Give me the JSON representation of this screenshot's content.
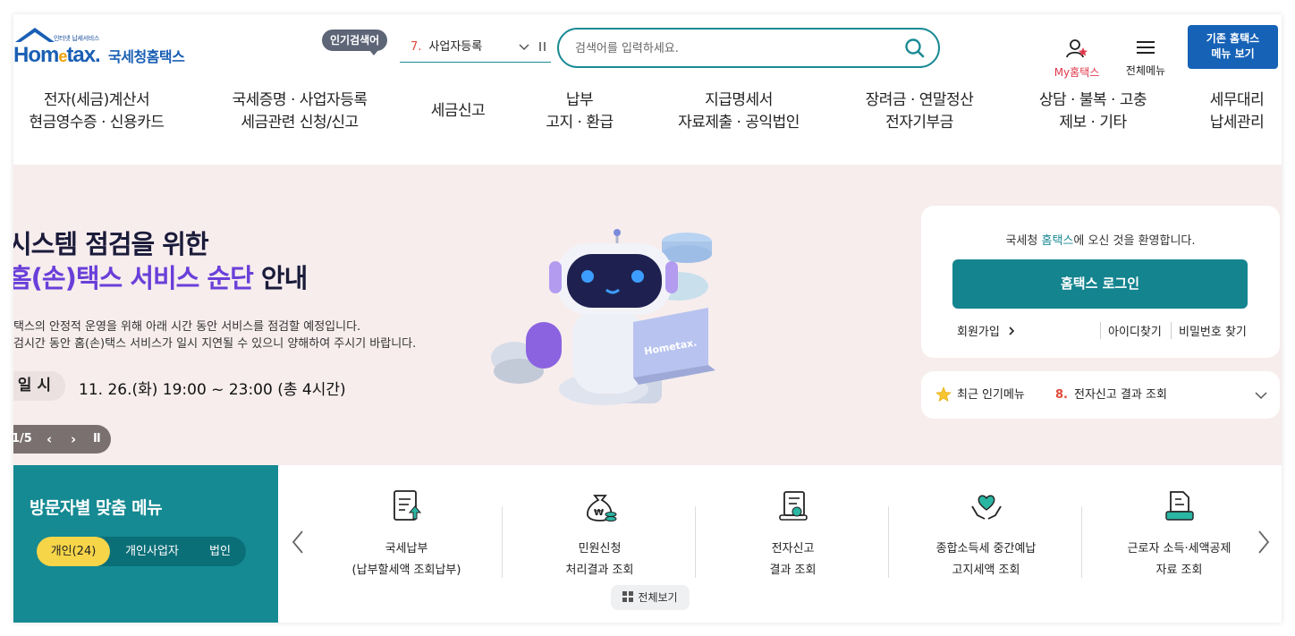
{
  "header": {
    "logo_sub": "인터넷 납세서비스",
    "logo_word_a": "Hom",
    "logo_word_e": "e",
    "logo_word_b": "tax.",
    "logo_kr": "국세청홈택스",
    "popular_badge": "인기검색어",
    "popular_rank": "7.",
    "popular_term": "사업자등록",
    "search_placeholder": "검색어를 입력하세요.",
    "my_label": "My홈택스",
    "all_menu_label": "전체메뉴",
    "old_menu_line1": "기존 홈택스",
    "old_menu_line2": "메뉴 보기"
  },
  "nav": [
    {
      "l1": "전자(세금)계산서",
      "l2": "현금영수증 · 신용카드"
    },
    {
      "l1": "국세증명 · 사업자등록",
      "l2": "세금관련 신청/신고"
    },
    {
      "l1": "세금신고",
      "l2": ""
    },
    {
      "l1": "납부",
      "l2": "고지 · 환급"
    },
    {
      "l1": "지급명세서",
      "l2": "자료제출 · 공익법인"
    },
    {
      "l1": "장려금 · 연말정산",
      "l2": "전자기부금"
    },
    {
      "l1": "상담 · 불복 · 고충",
      "l2": "제보 · 기타"
    },
    {
      "l1": "세무대리",
      "l2": "납세관리"
    }
  ],
  "banner": {
    "title_line1": "시스템 점검을 위한",
    "title_line2_accent": "홈(손)택스 서비스 순단",
    "title_line2_rest": " 안내",
    "desc1": "택스의 안정적 운영을 위해 아래 시간 동안 서비스를 점검할 예정입니다.",
    "desc2": "검시간 동안 홈(손)택스 서비스가 일시 지연될 수 있으니 양해하여 주시기 바랍니다.",
    "date_label": "일 시",
    "date_value": "11. 26.(화) 19:00 ~ 23:00 (총 4시간)",
    "page_indicator": "1/5",
    "robot_laptop_text": "Hometax."
  },
  "login": {
    "welcome_pre": "국세청 ",
    "welcome_hl": "홈택스",
    "welcome_post": "에 오신 것을 환영합니다.",
    "login_button": "홈택스 로그인",
    "join": "회원가입",
    "find_id": "아이디찾기",
    "find_pw": "비밀번호 찾기"
  },
  "recent": {
    "title": "최근 인기메뉴",
    "rank": "8.",
    "item": "전자신고 결과 조회"
  },
  "visitor": {
    "title": "방문자별 맞춤 메뉴",
    "tabs": [
      "개인(24)",
      "개인사업자",
      "법인"
    ]
  },
  "quick": {
    "items": [
      {
        "l1": "국세납부",
        "l2": "(납부할세액 조회납부)"
      },
      {
        "l1": "민원신청",
        "l2": "처리결과 조회"
      },
      {
        "l1": "전자신고",
        "l2": "결과 조회"
      },
      {
        "l1": "종합소득세 중간예납",
        "l2": "고지세액 조회"
      },
      {
        "l1": "근로자 소득·세액공제",
        "l2": "자료 조회"
      }
    ],
    "view_all": "전체보기"
  },
  "colors": {
    "brand_teal": "#158a93",
    "brand_blue": "#1662b7",
    "accent_red": "#e04a3a",
    "tab_active": "#f6d549",
    "banner_bg": "#f7eded"
  }
}
